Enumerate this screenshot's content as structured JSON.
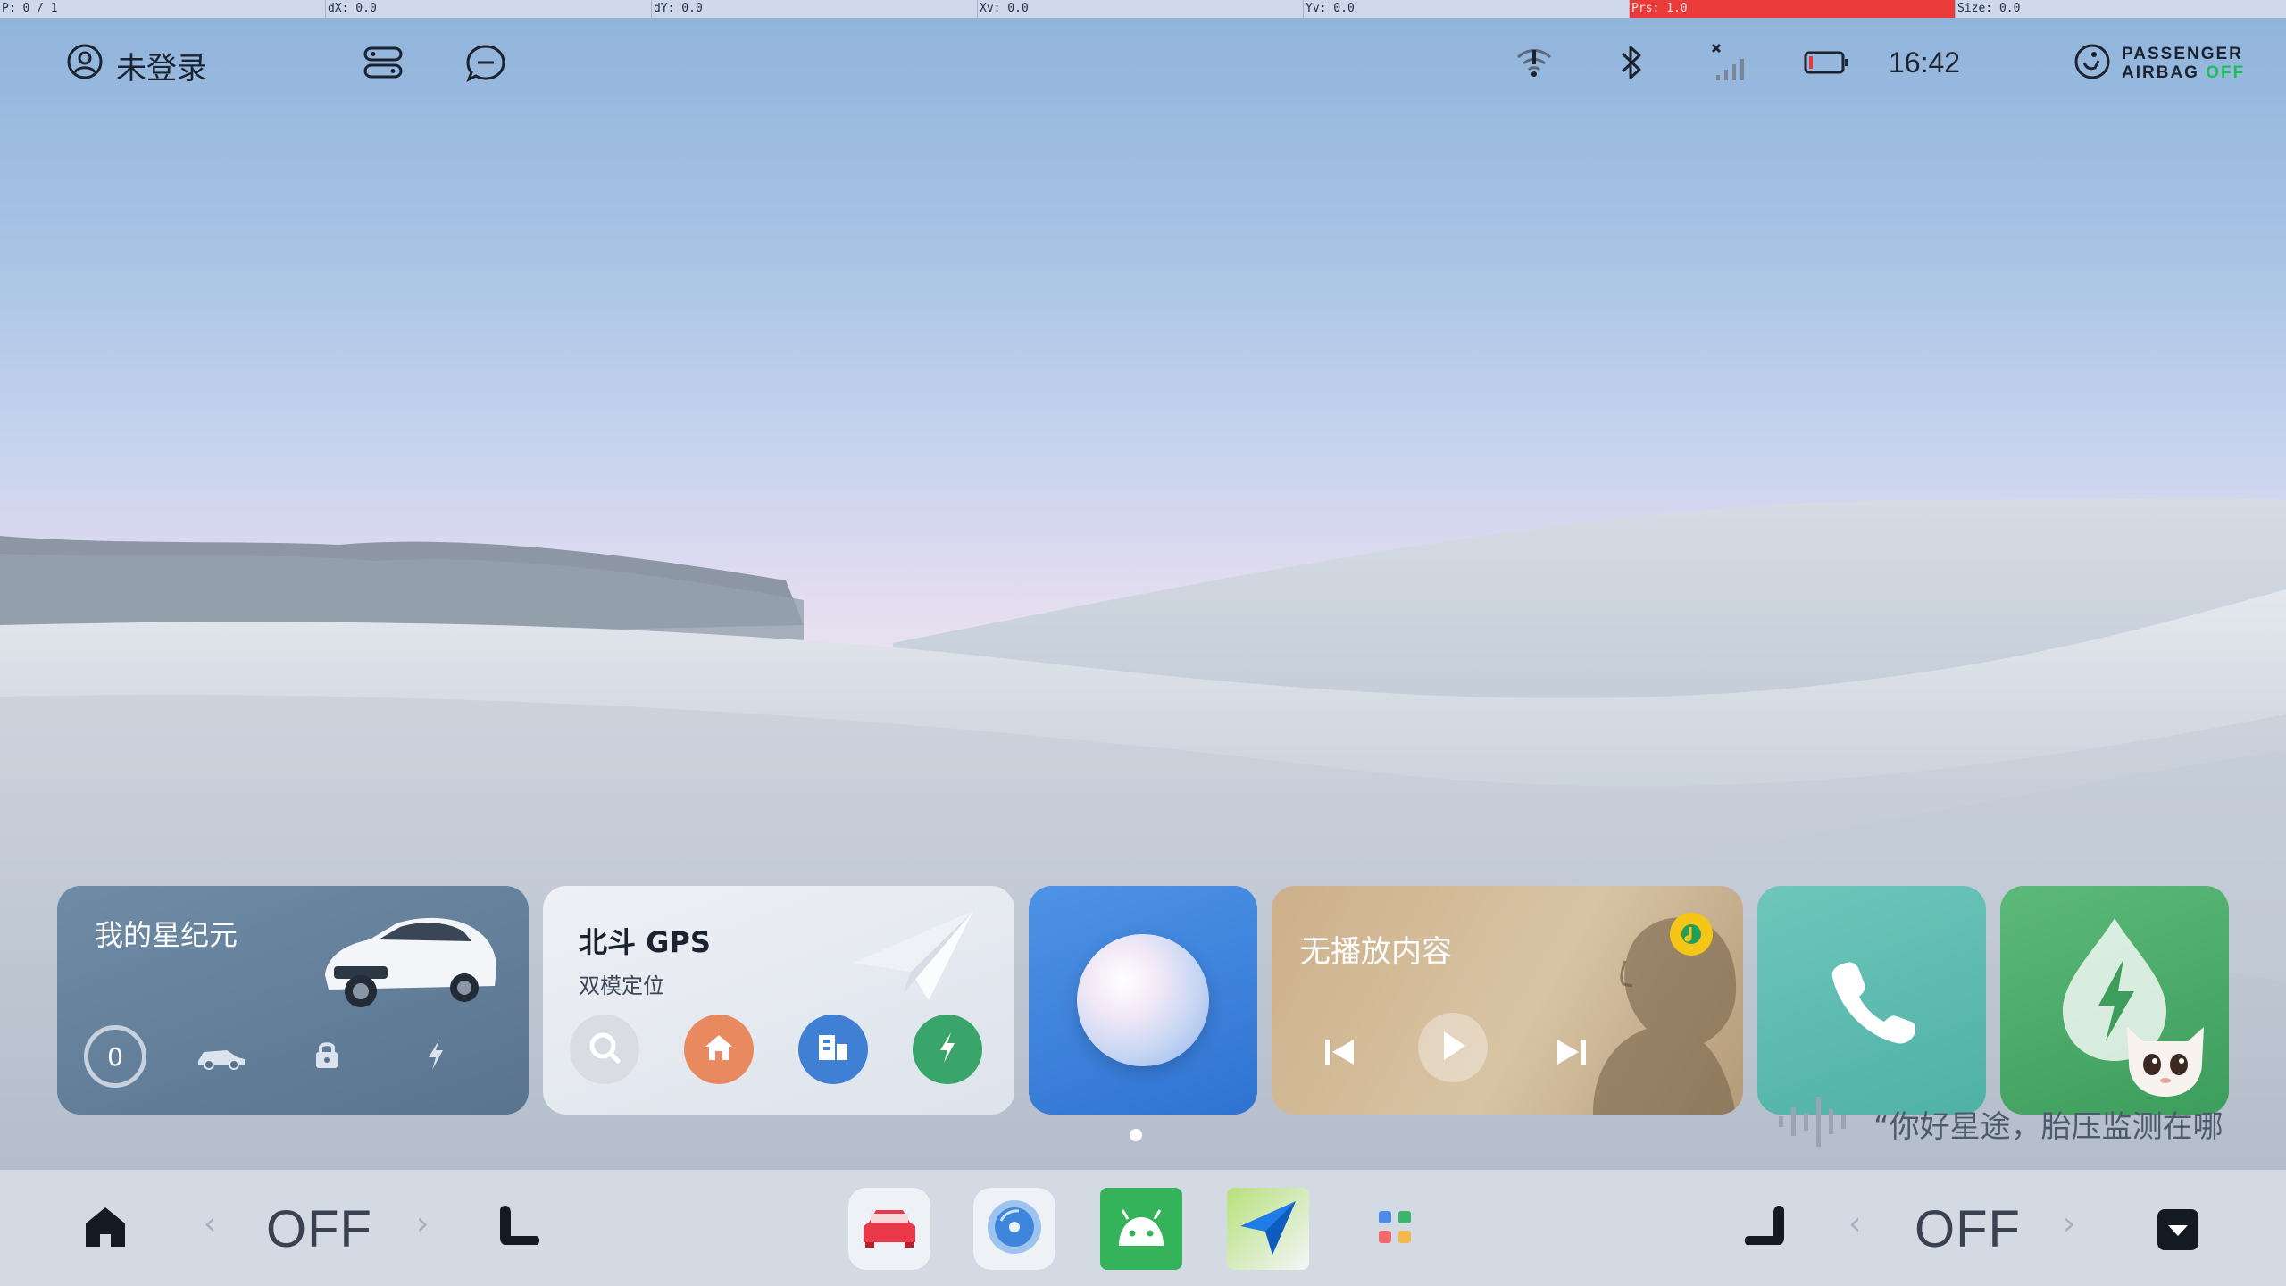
{
  "debug_bar": {
    "pointer": "P: 0 / 1",
    "dx": "dX: 0.0",
    "dy": "dY: 0.0",
    "xv": "Xv: 0.0",
    "yv": "Yv: 0.0",
    "prs": "Prs: 1.0",
    "size": "Size: 0.0"
  },
  "status_bar": {
    "login_text": "未登录",
    "time": "16:42",
    "airbag_line1": "PASSENGER",
    "airbag_line2": "AIRBAG",
    "airbag_state": "OFF",
    "icons": [
      "user-icon",
      "toggle-panel-icon",
      "message-icon",
      "wifi-icon",
      "bluetooth-icon",
      "cellular-signal-icon",
      "battery-icon",
      "airbag-icon"
    ]
  },
  "cards": {
    "car": {
      "title": "我的星纪元",
      "counter": "0",
      "icons": [
        "car-side-icon",
        "lock-icon",
        "charging-bolt-icon"
      ]
    },
    "navigation": {
      "title": "北斗 GPS",
      "subtitle": "双模定位",
      "icons": [
        "paper-plane-icon",
        "search-icon",
        "home-icon",
        "company-icon",
        "charging-bolt-icon"
      ]
    },
    "assistant": {
      "icon": "assistant-orb-icon"
    },
    "music": {
      "title": "无播放内容",
      "icons": [
        "music-app-icon",
        "previous-icon",
        "play-icon",
        "next-icon"
      ]
    },
    "phone": {
      "icon": "phone-icon"
    },
    "energy": {
      "icon": "energy-drop-icon"
    }
  },
  "page_indicator": {
    "count": 1,
    "active": 0
  },
  "voice_assistant": {
    "text": "“你好星途，胎压监测在哪"
  },
  "dock": {
    "left_seat_state": "OFF",
    "right_seat_state": "OFF",
    "apps": [
      "car-settings-app",
      "media-player-app",
      "android-app",
      "navigation-app",
      "app-grid"
    ],
    "icons": [
      "home-icon",
      "left-seat-icon",
      "right-seat-icon",
      "dropdown-icon"
    ]
  },
  "colors": {
    "airbag_off": "#19c05a",
    "debug_highlight": "#ea3a3a",
    "assistant_card": "#3f84dc"
  }
}
